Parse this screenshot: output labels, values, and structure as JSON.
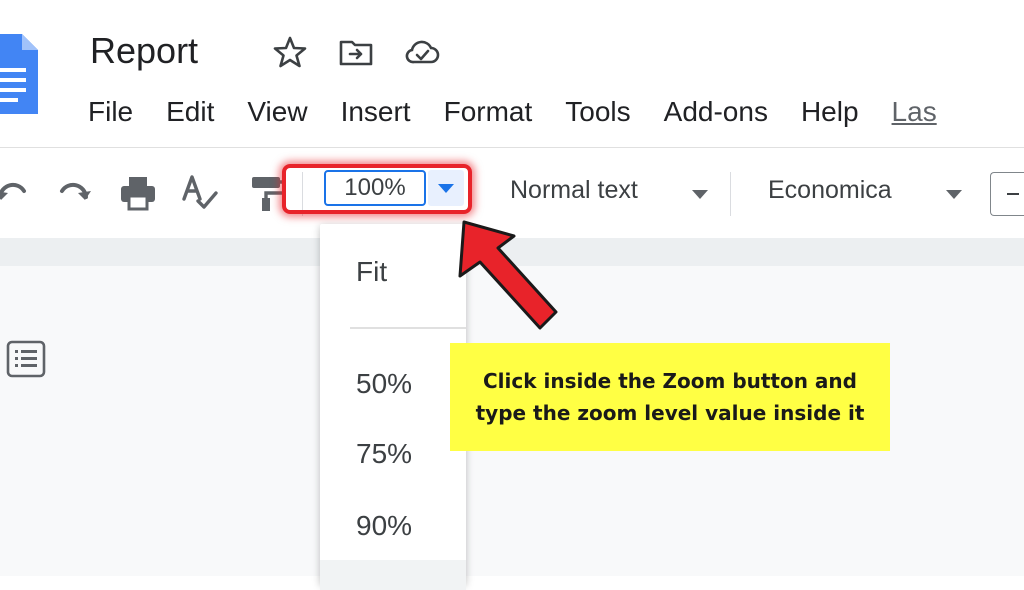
{
  "header": {
    "title": "Report",
    "icons": [
      "star-icon",
      "move-to-folder-icon",
      "cloud-status-icon"
    ],
    "menu": [
      "File",
      "Edit",
      "View",
      "Insert",
      "Format",
      "Tools",
      "Add-ons",
      "Help",
      "Las"
    ]
  },
  "toolbar": {
    "icons": [
      "undo-icon",
      "redo-icon",
      "print-icon",
      "spellcheck-icon",
      "paint-format-icon"
    ],
    "zoom_value": "100%",
    "style_label": "Normal text",
    "font_label": "Economica"
  },
  "zoom_menu": {
    "options": [
      "Fit",
      "50%",
      "75%",
      "90%"
    ]
  },
  "annotation": {
    "text": "Click inside the Zoom button and\ntype the zoom level value inside it"
  },
  "colors": {
    "highlight": "#e8232a",
    "callout_bg": "#ffff44",
    "docs_blue": "#4285f4",
    "zoom_focus": "#1a73e8"
  }
}
